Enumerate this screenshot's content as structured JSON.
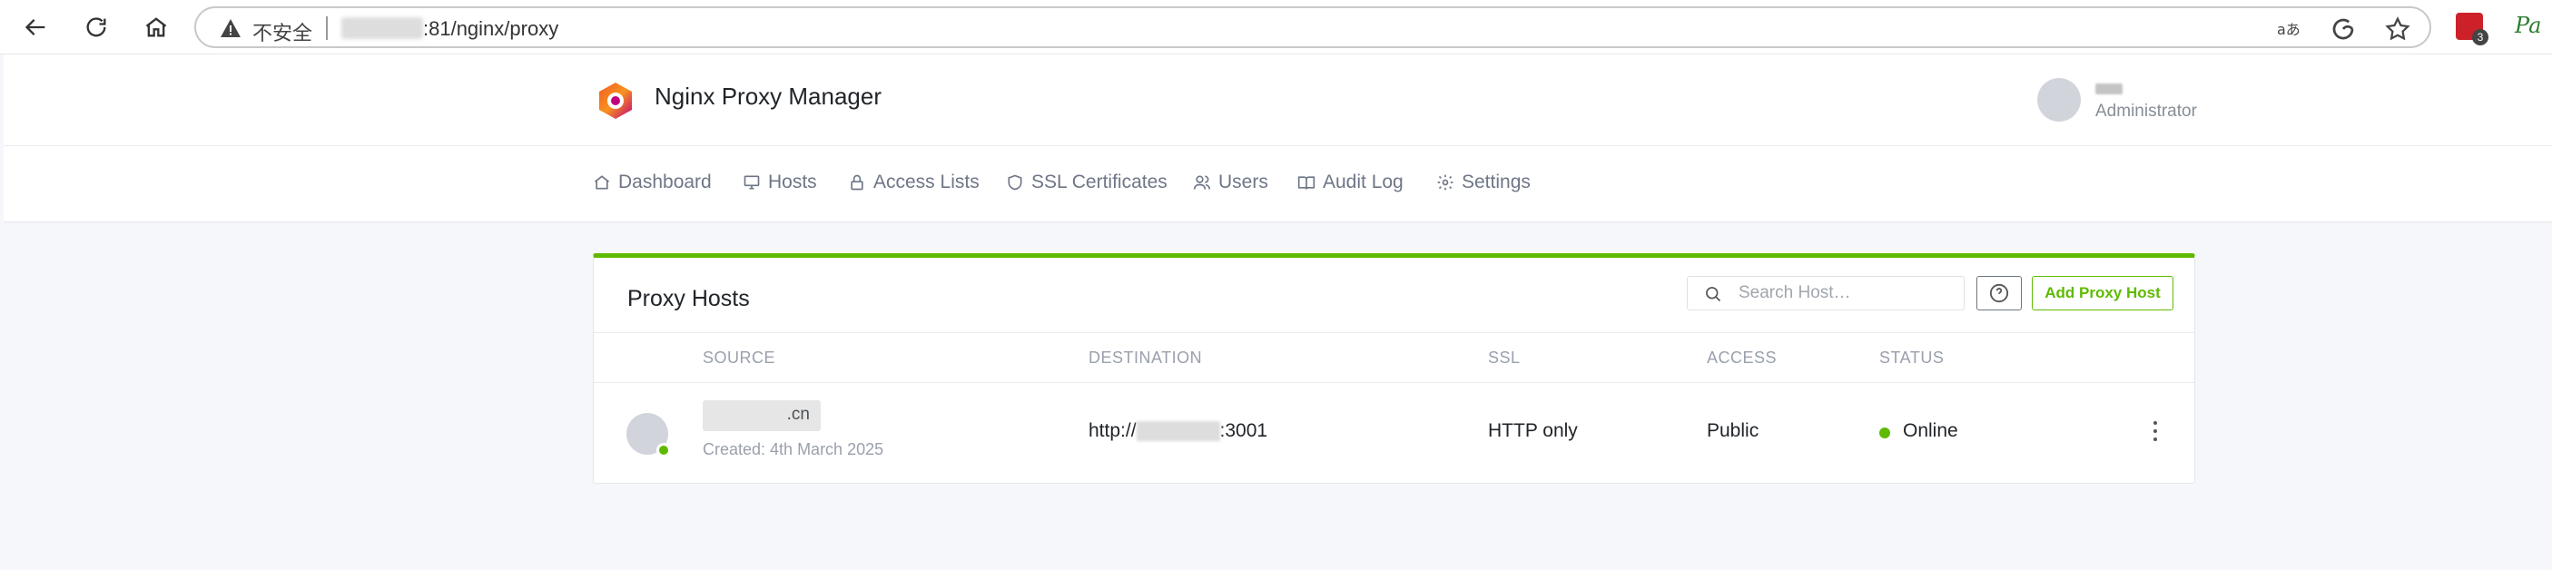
{
  "browser": {
    "security_label": "不安全",
    "url": ":81/nginx/proxy",
    "extension_badge": "3",
    "extension_pa": "Pa"
  },
  "app": {
    "title": "Nginx Proxy Manager",
    "user_role": "Administrator"
  },
  "nav": {
    "items": [
      {
        "label": "Dashboard",
        "icon": "home-icon"
      },
      {
        "label": "Hosts",
        "icon": "monitor-icon"
      },
      {
        "label": "Access Lists",
        "icon": "lock-icon"
      },
      {
        "label": "SSL Certificates",
        "icon": "shield-icon"
      },
      {
        "label": "Users",
        "icon": "users-icon"
      },
      {
        "label": "Audit Log",
        "icon": "book-icon"
      },
      {
        "label": "Settings",
        "icon": "gear-icon"
      }
    ]
  },
  "card": {
    "title": "Proxy Hosts",
    "search_placeholder": "Search Host…",
    "add_button": "Add Proxy Host",
    "accent_color": "#5eba00"
  },
  "table": {
    "headers": [
      "SOURCE",
      "DESTINATION",
      "SSL",
      "ACCESS",
      "STATUS"
    ],
    "rows": [
      {
        "source_suffix": ".cn",
        "created": "Created: 4th March 2025",
        "destination_prefix": "http://",
        "destination_suffix": ":3001",
        "ssl": "HTTP only",
        "access": "Public",
        "status": "Online"
      }
    ]
  }
}
